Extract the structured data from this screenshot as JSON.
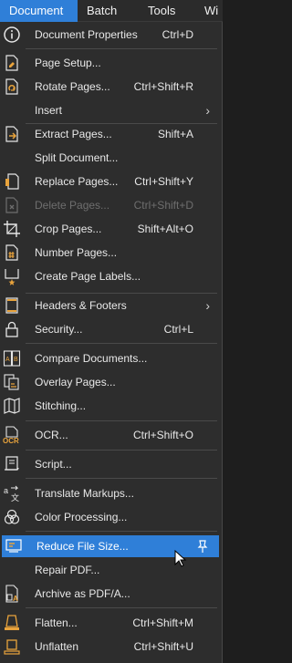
{
  "menubar": {
    "items": [
      {
        "label": "Document",
        "active": true
      },
      {
        "label": "Batch"
      },
      {
        "label": "Tools"
      },
      {
        "label": "Wi"
      }
    ]
  },
  "menu": {
    "items": [
      {
        "label": "Document Properties",
        "shortcut": "Ctrl+D",
        "icon": "info-icon"
      },
      {
        "label": "Page Setup...",
        "shortcut": "",
        "icon": "page-setup-icon"
      },
      {
        "label": "Rotate Pages...",
        "shortcut": "Ctrl+Shift+R",
        "icon": "rotate-pages-icon"
      },
      {
        "label": "Insert",
        "shortcut": "",
        "submenu": true
      },
      {
        "label": "Extract Pages...",
        "shortcut": "Shift+A",
        "icon": "extract-pages-icon"
      },
      {
        "label": "Split Document...",
        "shortcut": ""
      },
      {
        "label": "Replace Pages...",
        "shortcut": "Ctrl+Shift+Y",
        "icon": "replace-pages-icon"
      },
      {
        "label": "Delete Pages...",
        "shortcut": "Ctrl+Shift+D",
        "icon": "delete-pages-icon",
        "disabled": true
      },
      {
        "label": "Crop Pages...",
        "shortcut": "Shift+Alt+O",
        "icon": "crop-icon"
      },
      {
        "label": "Number Pages...",
        "shortcut": "",
        "icon": "number-pages-icon"
      },
      {
        "label": "Create Page Labels...",
        "shortcut": "",
        "icon": "page-labels-icon"
      },
      {
        "label": "Headers & Footers",
        "shortcut": "",
        "submenu": true
      },
      {
        "label": "Security...",
        "shortcut": "Ctrl+L",
        "icon": "lock-icon"
      },
      {
        "label": "Compare Documents...",
        "shortcut": "",
        "icon": "compare-documents-icon"
      },
      {
        "label": "Overlay Pages...",
        "shortcut": "",
        "icon": "overlay-pages-icon"
      },
      {
        "label": "Stitching...",
        "shortcut": "",
        "icon": "stitching-map-icon"
      },
      {
        "label": "OCR...",
        "shortcut": "Ctrl+Shift+O",
        "icon": "ocr-icon",
        "icon_text": "OCR"
      },
      {
        "label": "Script...",
        "shortcut": "",
        "icon": "script-icon"
      },
      {
        "label": "Translate Markups...",
        "shortcut": "",
        "icon": "translate-icon"
      },
      {
        "label": "Color Processing...",
        "shortcut": "",
        "icon": "color-processing-icon"
      },
      {
        "label": "Reduce File Size...",
        "shortcut": "",
        "icon": "reduce-file-size-icon",
        "highlighted": true
      },
      {
        "label": "Repair PDF...",
        "shortcut": ""
      },
      {
        "label": "Archive as PDF/A...",
        "shortcut": "",
        "icon": "archive-pdfa-icon",
        "icon_text": "A"
      },
      {
        "label": "Flatten...",
        "shortcut": "Ctrl+Shift+M",
        "icon": "flatten-icon"
      },
      {
        "label": "Unflatten",
        "shortcut": "Ctrl+Shift+U",
        "icon": "unflatten-icon"
      }
    ]
  },
  "colors": {
    "accent": "#2f7fd8",
    "menu_bg": "#2d2d2d",
    "icon_orange": "#e8a33c",
    "text": "#e8e8e8"
  }
}
